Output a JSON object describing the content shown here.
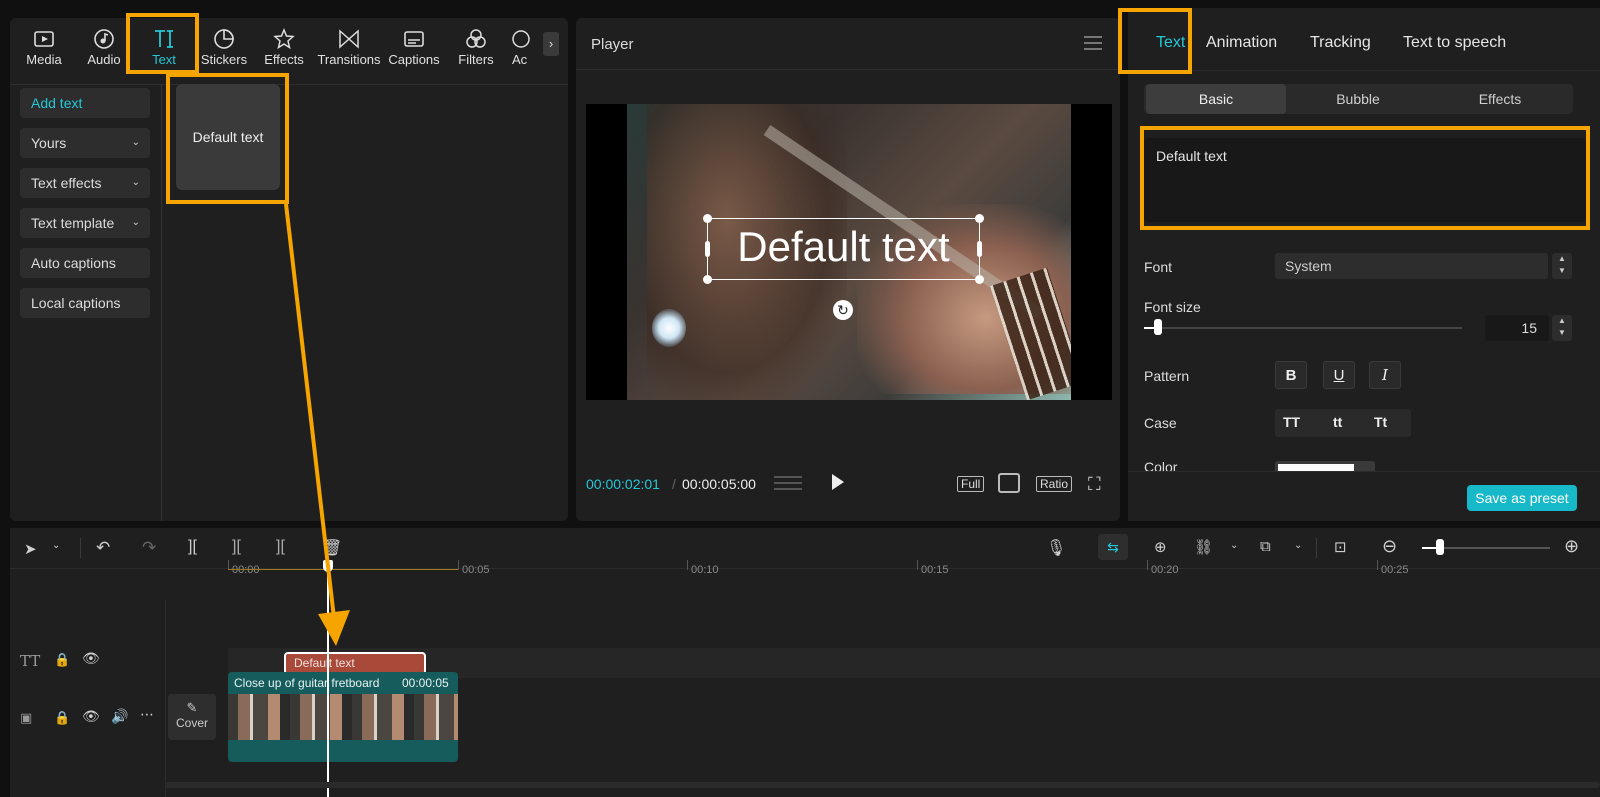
{
  "toolbar": {
    "tabs": [
      {
        "label": "Media",
        "icon": "media-icon"
      },
      {
        "label": "Audio",
        "icon": "audio-icon"
      },
      {
        "label": "Text",
        "icon": "text-icon"
      },
      {
        "label": "Stickers",
        "icon": "stickers-icon"
      },
      {
        "label": "Effects",
        "icon": "effects-icon"
      },
      {
        "label": "Transitions",
        "icon": "transitions-icon"
      },
      {
        "label": "Captions",
        "icon": "captions-icon"
      },
      {
        "label": "Filters",
        "icon": "filters-icon"
      },
      {
        "label": "Ac",
        "icon": "adjust-icon"
      }
    ],
    "active_tab": "Text",
    "accent": "#24c8d7",
    "highlight": "#f5a400"
  },
  "sidebar": {
    "items": [
      {
        "label": "Add text"
      },
      {
        "label": "Yours"
      },
      {
        "label": "Text effects"
      },
      {
        "label": "Text template"
      },
      {
        "label": "Auto captions"
      },
      {
        "label": "Local captions"
      }
    ]
  },
  "library": {
    "default_card": "Default text"
  },
  "player": {
    "title": "Player",
    "overlay_text": "Default text",
    "current_time": "00:00:02:01",
    "separator": "/",
    "total_time": "00:00:05:00",
    "full_label": "Full",
    "ratio_label": "Ratio"
  },
  "props": {
    "tabs": [
      "Text",
      "Animation",
      "Tracking",
      "Text to speech"
    ],
    "segments": [
      "Basic",
      "Bubble",
      "Effects"
    ],
    "text_value": "Default text",
    "font_label": "Font",
    "font_value": "System",
    "font_size_label": "Font size",
    "font_size_value": "15",
    "pattern_label": "Pattern",
    "pattern_buttons": [
      "B",
      "U",
      "I"
    ],
    "case_label": "Case",
    "case_buttons": [
      "TT",
      "tt",
      "Tt"
    ],
    "color_label": "Color",
    "save_preset": "Save as preset"
  },
  "timeline": {
    "ticks": [
      "00:00",
      "00:05",
      "00:10",
      "00:15",
      "00:20",
      "00:25"
    ],
    "text_clip": "Default text",
    "video_clip_title": "Close up of guitar fretboard",
    "video_clip_duration": "00:00:05",
    "cover_label": "Cover",
    "text_clip_color": "#a8493a",
    "video_clip_color": "#175c5c"
  }
}
